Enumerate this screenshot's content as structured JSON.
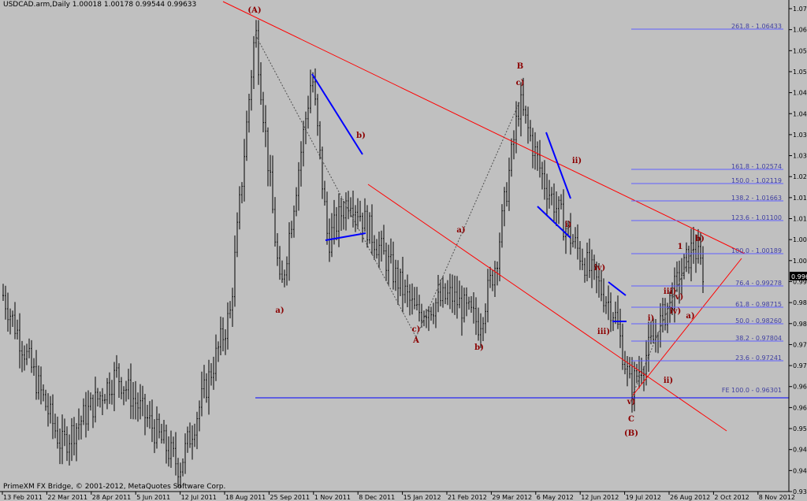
{
  "window": {
    "title": "USDCAD.arm,Daily  1.00018 1.00178 0.99544 0.99633",
    "footer": "PrimeXM FX Bridge, © 2001-2012, MetaQuotes Software Corp."
  },
  "colors": {
    "background": "#c0c0c0",
    "bar": "#000000",
    "channel": "#ff0000",
    "blue": "#0000ff",
    "fib": "#6060ff",
    "wave_label": "#8b0000",
    "fib_label": "#4040a0",
    "grid_text": "#000000",
    "price_box_bg": "#000000",
    "price_box_text": "#ffffff"
  },
  "price_axis": {
    "ticks": [
      "1.07040",
      "1.06455",
      "1.05880",
      "1.05300",
      "1.04720",
      "1.04160",
      "1.03575",
      "1.03005",
      "1.02435",
      "1.01850",
      "1.01280",
      "1.00695",
      "1.00125",
      "0.99540",
      "0.98970",
      "0.98400",
      "0.97815",
      "0.97245",
      "0.96675",
      "0.96090",
      "0.95520",
      "0.94950",
      "0.94365",
      "0.93795"
    ],
    "current": "0.99633"
  },
  "time_axis": {
    "labels": [
      "13 Feb 2011",
      "22 Mar 2011",
      "28 Apr 2011",
      "5 Jun 2011",
      "12 Jul 2011",
      "18 Aug 2011",
      "25 Sep 2011",
      "1 Nov 2011",
      "8 Dec 2011",
      "15 Jan 2012",
      "21 Feb 2012",
      "29 Mar 2012",
      "6 May 2012",
      "12 Jun 2012",
      "19 Jul 2012",
      "26 Aug 2012",
      "2 Oct 2012",
      "8 Nov 2012"
    ]
  },
  "fib_levels": [
    {
      "label": "261.8 - 1.06433"
    },
    {
      "label": "161.8 - 1.02574"
    },
    {
      "label": "150.0 - 1.02119"
    },
    {
      "label": "138.2 - 1.01663"
    },
    {
      "label": "123.6 - 1.01100"
    },
    {
      "label": "100.0 - 1.00189"
    },
    {
      "label": "76.4 - 0.99278"
    },
    {
      "label": "61.8 - 0.98715"
    },
    {
      "label": "50.0 - 0.98260"
    },
    {
      "label": "38.2 - 0.97804"
    },
    {
      "label": "23.6 - 0.97241"
    },
    {
      "label": "FE 100.0 - 0.96301"
    }
  ],
  "wave_labels": [
    "(A)",
    "a)",
    "b)",
    "c)",
    "A",
    "b)",
    "a)",
    "B",
    "c)",
    "ii)",
    "i)",
    "iv)",
    "iii)",
    "v)",
    "C",
    "(B)",
    "i)",
    "ii)",
    "iv)",
    "iii)",
    "v)",
    "1",
    "b)",
    "a)"
  ],
  "chart_data": {
    "type": "ohlc",
    "symbol": "USDCAD.arm",
    "timeframe": "Daily",
    "ohlc_header": {
      "open": 1.00018,
      "high": 1.00178,
      "low": 0.99544,
      "close": 0.99633
    },
    "y_range": [
      0.9352,
      1.0725
    ],
    "key_points": [
      {
        "date": "13 Feb 2011",
        "price": 0.99
      },
      {
        "date": "28 Apr 2011",
        "price": 0.948
      },
      {
        "date": "5 Jun 2011",
        "price": 0.968
      },
      {
        "date": "12 Jul 2011",
        "price": 0.942
      },
      {
        "date": "18 Aug 2011",
        "price": 0.985
      },
      {
        "date": "25 Sep 2011",
        "price": 1.065
      },
      {
        "date": "8 Oct 2011",
        "price": 0.99
      },
      {
        "date": "1 Nov 2011",
        "price": 1.052
      },
      {
        "date": "8 Dec 2011",
        "price": 1.005
      },
      {
        "date": "15 Jan 2012",
        "price": 1.018
      },
      {
        "date": "21 Feb 2012",
        "price": 0.985
      },
      {
        "date": "29 Mar 2012",
        "price": 0.99
      },
      {
        "date": "15 Apr 2012",
        "price": 0.982
      },
      {
        "date": "6 May 2012",
        "price": 1.0
      },
      {
        "date": "20 May 2012",
        "price": 1.044
      },
      {
        "date": "12 Jun 2012",
        "price": 1.022
      },
      {
        "date": "19 Jul 2012",
        "price": 1.007
      },
      {
        "date": "26 Aug 2012",
        "price": 0.985
      },
      {
        "date": "15 Sep 2012",
        "price": 0.964
      },
      {
        "date": "2 Oct 2012",
        "price": 0.979
      },
      {
        "date": "8 Nov 2012",
        "price": 1.004
      },
      {
        "date": "16 Nov 2012",
        "price": 0.996
      }
    ]
  }
}
